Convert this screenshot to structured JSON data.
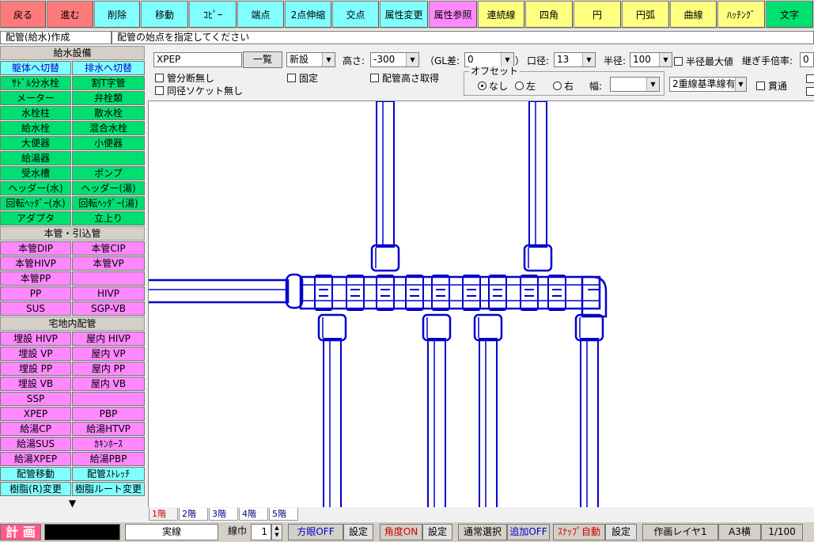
{
  "toolbar": {
    "buttons": [
      {
        "label": "戻る",
        "color": "#ff7b7b"
      },
      {
        "label": "進む",
        "color": "#ff7b7b"
      },
      {
        "label": "削除",
        "color": "#80ffff"
      },
      {
        "label": "移動",
        "color": "#80ffff"
      },
      {
        "label": "ｺﾋﾟｰ",
        "color": "#80ffff"
      },
      {
        "label": "端点",
        "color": "#80ffff"
      },
      {
        "label": "2点伸縮",
        "color": "#80ffff"
      },
      {
        "label": "交点",
        "color": "#80ffff"
      },
      {
        "label": "属性変更",
        "color": "#80ffff"
      },
      {
        "label": "属性参照",
        "color": "#ff88ff"
      },
      {
        "label": "連続線",
        "color": "#ffff80"
      },
      {
        "label": "四角",
        "color": "#ffff80"
      },
      {
        "label": "円",
        "color": "#ffff80"
      },
      {
        "label": "円弧",
        "color": "#ffff80"
      },
      {
        "label": "曲線",
        "color": "#ffff80"
      },
      {
        "label": "ﾊｯﾁﾝｸﾞ",
        "color": "#ffff80"
      },
      {
        "label": "文字",
        "color": "#00e070"
      }
    ]
  },
  "status": {
    "mode": "配管(給水)作成",
    "message": "配管の始点を指定してください"
  },
  "sidebar": {
    "header_water": "給水設備",
    "toggle_left": "躯体へ切替",
    "toggle_right": "排水へ切替",
    "water_items": [
      "ｻﾄﾞﾙ分水栓",
      "割T字管",
      "メーター",
      "弁栓類",
      "水栓柱",
      "散水栓",
      "給水栓",
      "混合水栓",
      "大便器",
      "小便器",
      "給湯器",
      "",
      "受水槽",
      "ポンプ",
      "ヘッダー(水)",
      "ヘッダー(湯)",
      "回転ﾍｯﾀﾞｰ(水)",
      "回転ﾍｯﾀﾞｰ(湯)",
      "アダプタ",
      "立上り"
    ],
    "header_main": "本管・引込管",
    "main_items": [
      "本管DIP",
      "本管CIP",
      "本管HIVP",
      "本管VP",
      "本管PP",
      "",
      "PP",
      "HIVP",
      "SUS",
      "SGP-VB"
    ],
    "header_yard": "宅地内配管",
    "yard_items": [
      "埋設 HIVP",
      "屋内 HIVP",
      "埋設 VP",
      "屋内 VP",
      "埋設 PP",
      "屋内 PP",
      "埋設 VB",
      "屋内 VB",
      "SSP",
      "",
      "XPEP",
      "PBP",
      "給湯CP",
      "給湯HTVP",
      "給湯SUS",
      "ｶｷﾝﾎｰｽ",
      "給湯XPEP",
      "給湯PBP"
    ],
    "tool_items": [
      "配管移動",
      "配管ｽﾄﾚｯﾁ",
      "樹脂(R)変更",
      "樹脂ルート変更"
    ],
    "more_arrow": "▼"
  },
  "options": {
    "pipe_type": "XPEP",
    "list_button": "一覧",
    "new_select": "新設",
    "height_label": "高さ:",
    "height_value": "-300",
    "gl_label": "（GL差:",
    "gl_value": "0",
    "gl_close": "）",
    "diameter_label": "口径:",
    "diameter_value": "13",
    "radius_label": "半径:",
    "radius_value": "100",
    "radius_max": "半径最大値",
    "joint_label": "継ぎ手倍率:",
    "joint_value": "0",
    "pipe_cut": "管分断無し",
    "same_socket": "同径ソケット無し",
    "fixed": "固定",
    "pipe_height_get": "配管高さ取得",
    "offset_label": "オフセット",
    "offset_none": "なし",
    "offset_left": "左",
    "offset_right": "右",
    "width_label": "幅:",
    "width_value": "",
    "double_line": "2重線基準線有",
    "through": "貫通"
  },
  "floors": {
    "tabs": [
      "1階",
      "2階",
      "3階",
      "4階",
      "5階"
    ],
    "active": "1階"
  },
  "bottom": {
    "plan_label": "計 画",
    "line_type": "実線",
    "line_width_label": "線巾",
    "line_width_value": "1",
    "grid": "方眼OFF",
    "grid_settings": "設定",
    "angle": "角度ON",
    "angle_settings": "設定",
    "select_mode": "通常選択",
    "add_mode": "追加OFF",
    "snap": "ｽﾅｯﾌﾟ自動",
    "snap_settings": "設定",
    "layer": "作画レイヤ1",
    "paper": "A3横",
    "scale": "1/100"
  },
  "colors": {
    "pipe": "#0000cc",
    "red_text": "#cc0000",
    "blue_text": "#0000cc"
  }
}
